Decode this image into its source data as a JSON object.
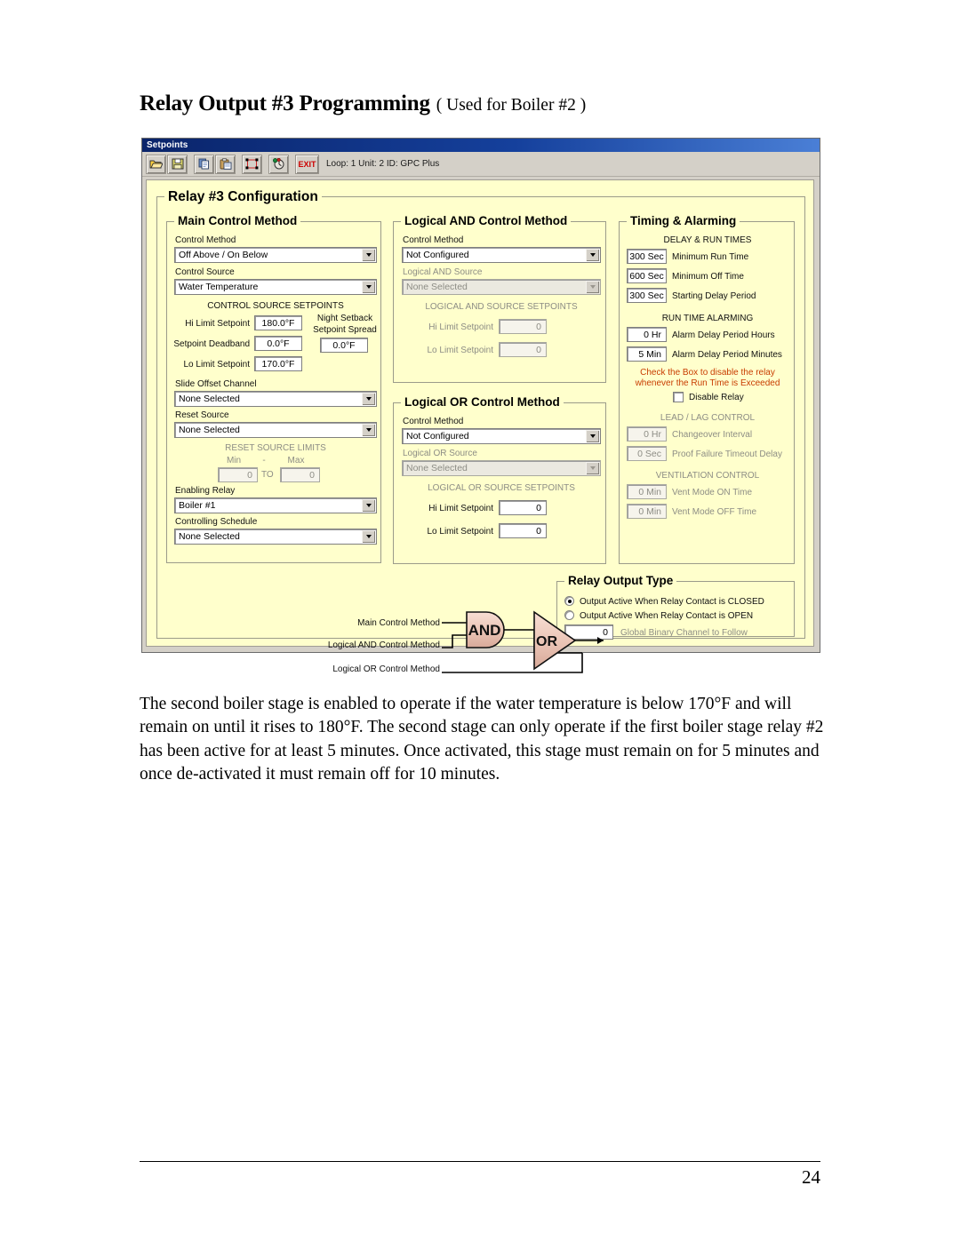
{
  "document": {
    "heading_main": "Relay Output #3 Programming",
    "heading_sub": "( Used for Boiler #2 )",
    "body_paragraph": "The second boiler stage is enabled to operate if the water temperature is below 170°F and will remain on until it rises to 180°F. The second stage can only operate if the first boiler stage relay #2 has been active for at least 5 minutes. Once activated, this stage must remain on for 5 minutes and once de-activated it must remain off for 10 minutes.",
    "page_number": "24"
  },
  "window": {
    "title": "Setpoints",
    "status": "Loop: 1  Unit: 2  ID: GPC Plus",
    "toolbar": {
      "open_label": "open-folder",
      "save_label": "save-disk",
      "copy_label": "copy",
      "paste_label": "paste",
      "select_label": "select-region",
      "clock_label": "clock-tool",
      "exit_label": "EXIT"
    },
    "frame_title": "Relay #3 Configuration"
  },
  "main_control": {
    "group_title": "Main Control Method",
    "control_method_label": "Control Method",
    "control_method_value": "Off Above / On Below",
    "control_source_label": "Control Source",
    "control_source_value": "Water Temperature",
    "setpoints_header": "CONTROL SOURCE SETPOINTS",
    "hi_limit_label": "Hi Limit Setpoint",
    "hi_limit_value": "180.0°F",
    "deadband_label": "Setpoint Deadband",
    "deadband_value": "0.0°F",
    "lo_limit_label": "Lo Limit Setpoint",
    "lo_limit_value": "170.0°F",
    "night_setback_label_1": "Night Setback",
    "night_setback_label_2": "Setpoint Spread",
    "night_setback_value": "0.0°F",
    "slide_offset_label": "Slide Offset Channel",
    "slide_offset_value": "None Selected",
    "reset_source_label": "Reset Source",
    "reset_source_value": "None Selected",
    "reset_limits_header": "RESET SOURCE LIMITS",
    "min_label": "Min",
    "dash_label": "-",
    "max_label": "Max",
    "min_value": "0",
    "to_label": "TO",
    "max_value": "0",
    "enabling_relay_label": "Enabling Relay",
    "enabling_relay_value": "Boiler #1",
    "controlling_schedule_label": "Controlling Schedule",
    "controlling_schedule_value": "None Selected"
  },
  "logical_and": {
    "group_title": "Logical AND Control Method",
    "control_method_label": "Control Method",
    "control_method_value": "Not Configured",
    "source_label": "Logical AND Source",
    "source_value": "None Selected",
    "setpoints_header": "LOGICAL AND SOURCE SETPOINTS",
    "hi_limit_label": "Hi Limit Setpoint",
    "hi_limit_value": "0",
    "lo_limit_label": "Lo Limit Setpoint",
    "lo_limit_value": "0"
  },
  "logical_or": {
    "group_title": "Logical OR Control Method",
    "control_method_label": "Control Method",
    "control_method_value": "Not Configured",
    "source_label": "Logical OR Source",
    "source_value": "None Selected",
    "setpoints_header": "LOGICAL OR SOURCE SETPOINTS",
    "hi_limit_label": "Hi Limit Setpoint",
    "hi_limit_value": "0",
    "lo_limit_label": "Lo Limit Setpoint",
    "lo_limit_value": "0"
  },
  "timing": {
    "group_title": "Timing & Alarming",
    "delay_header": "DELAY & RUN TIMES",
    "min_run_value": "300 Sec",
    "min_run_label": "Minimum Run Time",
    "min_off_value": "600 Sec",
    "min_off_label": "Minimum Off Time",
    "start_delay_value": "300 Sec",
    "start_delay_label": "Starting Delay Period",
    "alarm_header": "RUN TIME ALARMING",
    "alarm_hours_value": "0 Hr",
    "alarm_hours_label": "Alarm Delay Period Hours",
    "alarm_minutes_value": "5 Min",
    "alarm_minutes_label": "Alarm Delay Period Minutes",
    "warning_line_1": "Check the Box to disable the relay",
    "warning_line_2": "whenever the Run Time is Exceeded",
    "warning_color": "#c83c00",
    "disable_relay_label": "Disable Relay",
    "disable_relay_checked": false,
    "leadlag_header": "LEAD / LAG CONTROL",
    "changeover_value": "0 Hr",
    "changeover_label": "Changeover Interval",
    "proof_value": "0 Sec",
    "proof_label": "Proof Failure Timeout Delay",
    "vent_header": "VENTILATION CONTROL",
    "vent_on_value": "0 Min",
    "vent_on_label": "Vent Mode ON Time",
    "vent_off_value": "0 Min",
    "vent_off_label": "Vent Mode OFF Time"
  },
  "relay_output_type": {
    "group_title": "Relay Output Type",
    "option_closed": "Output Active When Relay Contact is CLOSED",
    "option_open": "Output Active When Relay Contact is OPEN",
    "selected": "closed",
    "global_binary_value": "0",
    "global_binary_label": "Global Binary Channel to Follow"
  },
  "logic_diagram": {
    "input_main": "Main Control Method",
    "input_and": "Logical AND Control Method",
    "input_or": "Logical OR Control Method",
    "gate_and": "AND",
    "gate_or": "OR",
    "gate_fill": "#e8c8bc"
  }
}
